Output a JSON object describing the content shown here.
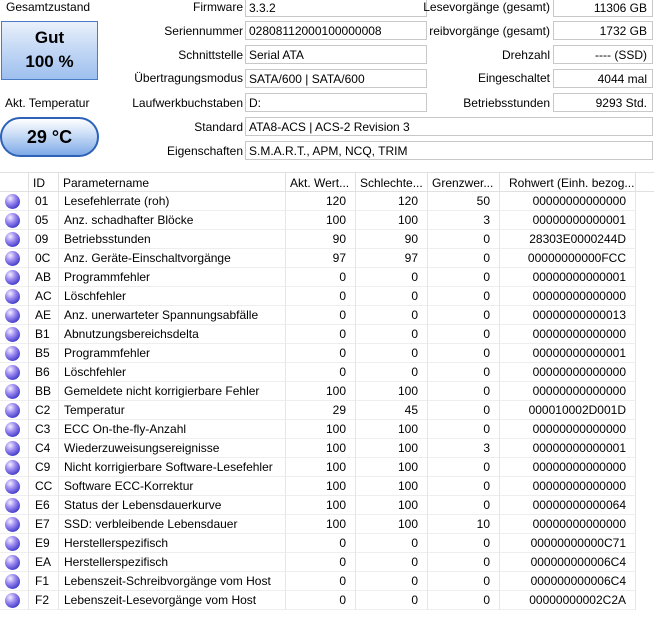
{
  "status": {
    "heading": "Gesamtzustand",
    "state": "Gut",
    "percent": "100 %",
    "temp_heading": "Akt. Temperatur",
    "temp_value": "29 °C",
    "status_color": "#9ebfee"
  },
  "info_left": {
    "firmware": {
      "label": "Firmware",
      "value": "3.3.2"
    },
    "serial": {
      "label": "Seriennummer",
      "value": "02808112000100000008"
    },
    "interface": {
      "label": "Schnittstelle",
      "value": "Serial ATA"
    },
    "transfer": {
      "label": "Übertragungsmodus",
      "value": "SATA/600 | SATA/600"
    },
    "drive_letter": {
      "label": "Laufwerkbuchstaben",
      "value": "D:"
    },
    "standard": {
      "label": "Standard",
      "value": "ATA8-ACS | ACS-2 Revision 3"
    },
    "features": {
      "label": "Eigenschaften",
      "value": "S.M.A.R.T., APM, NCQ, TRIM"
    }
  },
  "info_right": {
    "reads": {
      "label": "Lesevorgänge (gesamt)",
      "value": "11306 GB"
    },
    "writes": {
      "label": "reibvorgänge (gesamt)",
      "value": "1732 GB"
    },
    "rpm": {
      "label": "Drehzahl",
      "value": "---- (SSD)"
    },
    "power_count": {
      "label": "Eingeschaltet",
      "value": "4044 mal"
    },
    "power_hours": {
      "label": "Betriebsstunden",
      "value": "9293 Std."
    }
  },
  "table": {
    "headers": [
      "ID",
      "Parametername",
      "Akt. Wert...",
      "Schlechte...",
      "Grenzwer...",
      "Rohwert (Einh. bezog..."
    ],
    "rows": [
      [
        "01",
        "Lesefehlerrate (roh)",
        "120",
        "120",
        "50",
        "00000000000000"
      ],
      [
        "05",
        "Anz. schadhafter Blöcke",
        "100",
        "100",
        "3",
        "00000000000001"
      ],
      [
        "09",
        "Betriebsstunden",
        "90",
        "90",
        "0",
        "28303E0000244D"
      ],
      [
        "0C",
        "Anz. Geräte-Einschaltvorgänge",
        "97",
        "97",
        "0",
        "00000000000FCC"
      ],
      [
        "AB",
        "Programmfehler",
        "0",
        "0",
        "0",
        "00000000000001"
      ],
      [
        "AC",
        "Löschfehler",
        "0",
        "0",
        "0",
        "00000000000000"
      ],
      [
        "AE",
        "Anz. unerwarteter Spannungsabfälle",
        "0",
        "0",
        "0",
        "00000000000013"
      ],
      [
        "B1",
        "Abnutzungsbereichsdelta",
        "0",
        "0",
        "0",
        "00000000000000"
      ],
      [
        "B5",
        "Programmfehler",
        "0",
        "0",
        "0",
        "00000000000001"
      ],
      [
        "B6",
        "Löschfehler",
        "0",
        "0",
        "0",
        "00000000000000"
      ],
      [
        "BB",
        "Gemeldete nicht korrigierbare Fehler",
        "100",
        "100",
        "0",
        "00000000000000"
      ],
      [
        "C2",
        "Temperatur",
        "29",
        "45",
        "0",
        "000010002D001D"
      ],
      [
        "C3",
        "ECC On-the-fly-Anzahl",
        "100",
        "100",
        "0",
        "00000000000000"
      ],
      [
        "C4",
        "Wiederzuweisungsereignisse",
        "100",
        "100",
        "3",
        "00000000000001"
      ],
      [
        "C9",
        "Nicht korrigierbare Software-Lesefehler",
        "100",
        "100",
        "0",
        "00000000000000"
      ],
      [
        "CC",
        "Software ECC-Korrektur",
        "100",
        "100",
        "0",
        "00000000000000"
      ],
      [
        "E6",
        "Status der Lebensdauerkurve",
        "100",
        "100",
        "0",
        "00000000000064"
      ],
      [
        "E7",
        "SSD: verbleibende Lebensdauer",
        "100",
        "100",
        "10",
        "00000000000000"
      ],
      [
        "E9",
        "Herstellerspezifisch",
        "0",
        "0",
        "0",
        "00000000000C71"
      ],
      [
        "EA",
        "Herstellerspezifisch",
        "0",
        "0",
        "0",
        "000000000006C4"
      ],
      [
        "F1",
        "Lebenszeit-Schreibvorgänge vom Host",
        "0",
        "0",
        "0",
        "000000000006C4"
      ],
      [
        "F2",
        "Lebenszeit-Lesevorgänge vom Host",
        "0",
        "0",
        "0",
        "00000000002C2A"
      ]
    ]
  }
}
